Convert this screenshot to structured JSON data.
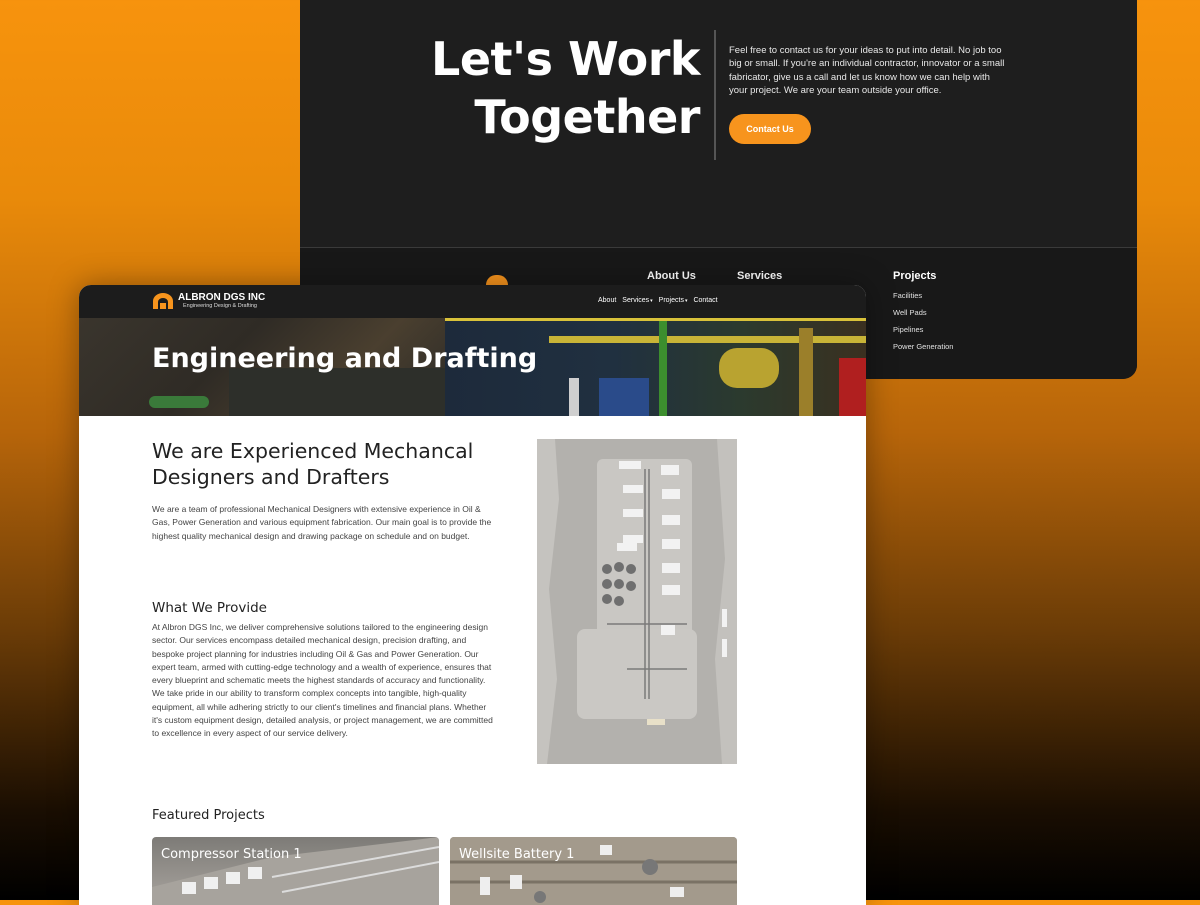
{
  "cta": {
    "title_line1": "Let's Work",
    "title_line2": "Together",
    "text": "Feel free to contact us for your ideas to put into detail. No job too big or small. If you're an individual contractor, innovator or a small fabricator, give us a call and let us know how we can help with your project. We are your team outside your office.",
    "button": "Contact Us"
  },
  "footer": {
    "about_heading": "About Us",
    "services_heading": "Services",
    "projects_heading": "Projects",
    "projects_links": [
      "Facilities",
      "Well Pads",
      "Pipelines",
      "Power Generation"
    ]
  },
  "nav": {
    "brand": "ALBRON DGS INC",
    "tagline": "Engineering Design & Drafting",
    "links": [
      "About",
      "Services",
      "Projects",
      "Contact"
    ]
  },
  "hero": {
    "title": "Engineering and Drafting"
  },
  "intro": {
    "heading": "We are Experienced Mechancal Designers and Drafters",
    "body": "We are a team of professional Mechanical Designers with extensive experience in Oil & Gas, Power Generation and various equipment fabrication. Our main goal is to provide the highest quality mechanical design and drawing package on schedule and on budget."
  },
  "provide": {
    "heading": "What We Provide",
    "body": "At Albron DGS Inc, we deliver comprehensive solutions tailored to the engineering design sector. Our services encompass detailed mechanical design, precision drafting, and bespoke project planning for industries including Oil & Gas and Power Generation. Our expert team, armed with cutting-edge technology and a wealth of experience, ensures that every blueprint and schematic meets the highest standards of accuracy and functionality. We take pride in our ability to transform complex concepts into tangible, high-quality equipment, all while adhering strictly to our client's timelines and financial plans. Whether it's custom equipment design, detailed analysis, or project management, we are committed to excellence in every aspect of our service delivery."
  },
  "featured": {
    "heading": "Featured Projects",
    "projects": [
      "Compressor Station 1",
      "Wellsite Battery 1"
    ]
  },
  "colors": {
    "accent": "#f7941d",
    "dark": "#1e1e1e"
  }
}
